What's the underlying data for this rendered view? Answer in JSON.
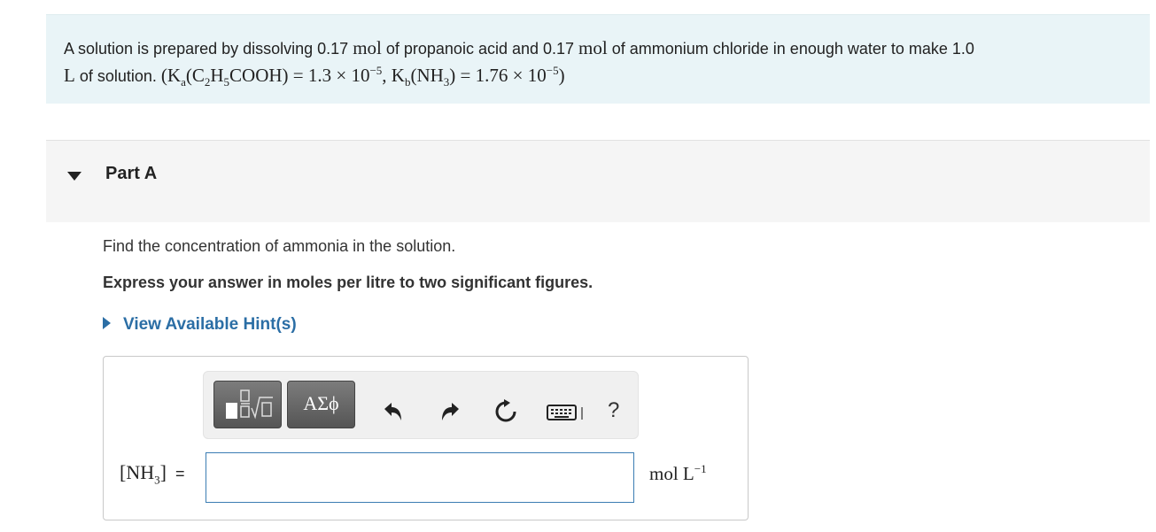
{
  "problem": {
    "t1": "A solution is prepared by dissolving 0.17 ",
    "mol1": "mol",
    "t2": " of propanoic acid and 0.17 ",
    "mol2": "mol",
    "t3": " of ammonium chloride in enough water to make 1.0",
    "L": "L",
    "t4": " of solution. ",
    "eq_a_open": "(K",
    "eq_a_sub": "a",
    "eq_a_formula_1": "(C",
    "eq_a_formula_sub2": "2",
    "eq_a_formula_2": "H",
    "eq_a_formula_sub5": "5",
    "eq_a_formula_3": "COOH) = 1.3 × 10",
    "eq_a_exp": "−5",
    "eq_sep": ", K",
    "eq_b_sub": "b",
    "eq_b_1": "(NH",
    "eq_b_sub3": "3",
    "eq_b_2": ") = 1.76 × 10",
    "eq_b_exp": "−5",
    "eq_close": ")"
  },
  "part": {
    "title": "Part A",
    "instruction": "Find the concentration of ammonia in the solution.",
    "express": "Express your answer in moles per litre to two significant figures.",
    "hint_label": "View Available Hint(s)"
  },
  "toolbar": {
    "symbols_label": "ΑΣϕ",
    "help_label": "?"
  },
  "answer": {
    "label_open": "[NH",
    "label_sub": "3",
    "label_close": "]",
    "equals": "=",
    "value": "",
    "unit": "mol L",
    "unit_exp": "−1"
  }
}
